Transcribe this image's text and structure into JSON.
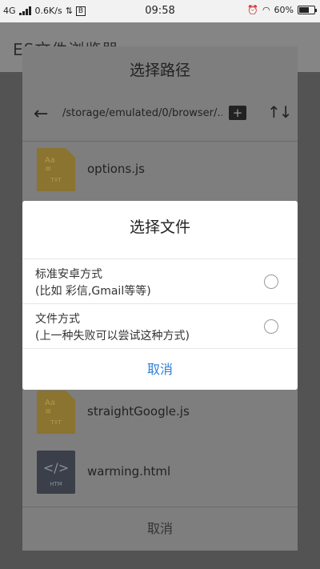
{
  "status_bar": {
    "network": "4G",
    "speed": "0.6K/s",
    "usb_icon": "usb-icon",
    "b_badge": "B",
    "time": "09:58",
    "battery": "60%"
  },
  "app": {
    "title": "ES文件浏览器"
  },
  "path_dialog": {
    "title": "选择路径",
    "path": "/storage/emulated/0/browser/…",
    "files": [
      {
        "name": "options.js",
        "icon": "txt-file-icon",
        "ext": "TXT"
      },
      {
        "name": "straightGoogle.js",
        "icon": "txt-file-icon",
        "ext": "TXT"
      },
      {
        "name": "warming.html",
        "icon": "html-file-icon",
        "ext": "HTM"
      }
    ],
    "cancel_label": "取消"
  },
  "choose_dialog": {
    "title": "选择文件",
    "options": [
      {
        "line1": "标准安卓方式",
        "line2": "(比如 彩信,Gmail等等)"
      },
      {
        "line1": "文件方式",
        "line2": "(上一种失败可以尝试这种方式)"
      }
    ],
    "cancel_label": "取消"
  },
  "colors": {
    "accent": "#2c7fd8"
  }
}
